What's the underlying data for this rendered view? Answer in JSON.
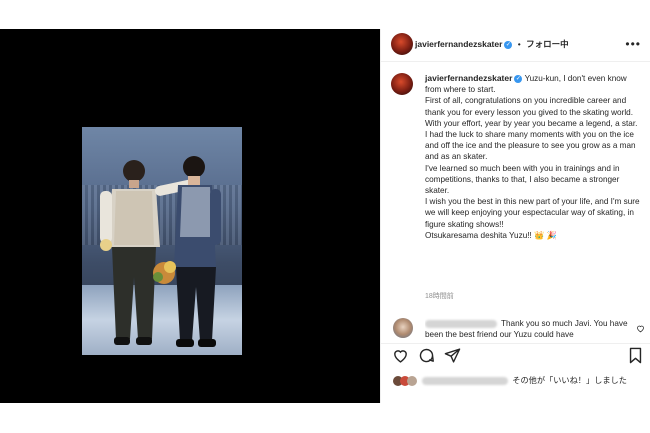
{
  "header": {
    "username": "javierfernandezskater",
    "separator": "•",
    "follow_label": "フォロー中",
    "more_icon": "more-horizontal-icon"
  },
  "caption": {
    "username": "javierfernandezskater",
    "lines": [
      "Yuzu-kun, I don't even know from where to start.",
      "First of all, congratulations on you incredible career and thank you for every lesson you gived to the skating world. With your effort, year by year you became a legend, a star.",
      "I had the luck to share many moments with you on the ice and off the ice and the pleasure to see you grow as a man and as an skater.",
      "I've learned so much been with you in trainings and in competitions, thanks to that, I also became a stronger skater.",
      "I wish you the best in this new part of your life, and I'm sure we will keep enjoying your espectacular way of skating, in figure skating shows!!",
      "Otsukaresama deshita Yuzu!! 👑 🎉"
    ],
    "time": "18時間前"
  },
  "comment": {
    "text": "Thank you so much Javi. You have been the best friend our Yuzu could have"
  },
  "actions": {
    "like_icon": "heart-icon",
    "comment_icon": "comment-icon",
    "share_icon": "send-icon",
    "save_icon": "bookmark-icon"
  },
  "likes": {
    "suffix": "その他が「いいね！」しました"
  },
  "colors": {
    "verified": "#3897f0",
    "text": "#262626",
    "muted": "#8e8e8e"
  }
}
